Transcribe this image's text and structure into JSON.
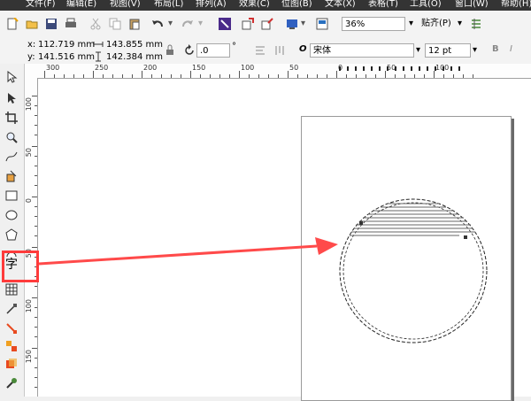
{
  "menu": [
    "文件(F)",
    "编辑(E)",
    "视图(V)",
    "布局(L)",
    "排列(A)",
    "效果(C)",
    "位图(B)",
    "文本(X)",
    "表格(T)",
    "工具(O)",
    "窗口(W)",
    "帮助(H)"
  ],
  "toolbar": {
    "zoom": "36%",
    "snap_label": "贴齐(P)"
  },
  "propbar": {
    "x_label": "x:",
    "x_value": "112.719 mm",
    "y_label": "y:",
    "y_value": "141.516 mm",
    "width_value": "143.855 mm",
    "height_value": "142.384 mm",
    "rotation": ".0",
    "degree_symbol": "°",
    "font_name": "宋体",
    "font_size": "12 pt"
  },
  "ruler": {
    "h_labels": [
      "300",
      "250",
      "200",
      "150",
      "100",
      "50",
      "0",
      "50",
      "100"
    ],
    "v_labels": [
      "100",
      "50",
      "0",
      "50",
      "100",
      "150"
    ]
  },
  "colors": {
    "highlight": "#ff3b3b",
    "arrow": "#ff4a4a",
    "menubar": "#343434"
  }
}
